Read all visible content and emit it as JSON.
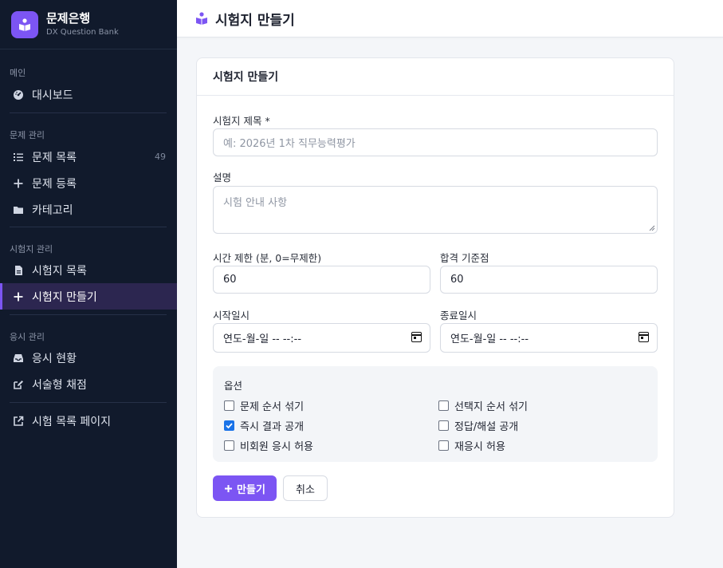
{
  "brand": {
    "title": "문제은행",
    "subtitle": "DX Question Bank"
  },
  "sidebar": {
    "sections": [
      {
        "label": "메인",
        "items": [
          {
            "label": "대시보드",
            "icon": "dashboard-icon"
          }
        ]
      },
      {
        "label": "문제 관리",
        "items": [
          {
            "label": "문제 목록",
            "icon": "list-icon",
            "count": "49"
          },
          {
            "label": "문제 등록",
            "icon": "plus-icon"
          },
          {
            "label": "카테고리",
            "icon": "folder-icon"
          }
        ]
      },
      {
        "label": "시험지 관리",
        "items": [
          {
            "label": "시험지 목록",
            "icon": "file-icon"
          },
          {
            "label": "시험지 만들기",
            "icon": "plus-icon",
            "active": true
          }
        ]
      },
      {
        "label": "응시 관리",
        "items": [
          {
            "label": "응시 현황",
            "icon": "inbox-icon"
          },
          {
            "label": "서술형 채점",
            "icon": "edit-icon"
          }
        ]
      }
    ],
    "footer_item": {
      "label": "시험 목록 페이지",
      "icon": "external-link-icon"
    }
  },
  "header": {
    "title": "시험지 만들기"
  },
  "form": {
    "card_title": "시험지 만들기",
    "title_label": "시험지 제목 *",
    "title_placeholder": "예: 2026년 1차 직무능력평가",
    "desc_label": "설명",
    "desc_placeholder": "시험 안내 사항",
    "time_label": "시간 제한 (분, 0=무제한)",
    "time_value": "60",
    "pass_label": "합격 기준점",
    "pass_value": "60",
    "start_label": "시작일시",
    "start_value": "연도-월-일 -- --:--",
    "end_label": "종료일시",
    "end_value": "연도-월-일 -- --:--",
    "options_title": "옵션",
    "options": [
      {
        "label": "문제 순서 섞기",
        "checked": false
      },
      {
        "label": "선택지 순서 섞기",
        "checked": false
      },
      {
        "label": "즉시 결과 공개",
        "checked": true
      },
      {
        "label": "정답/해설 공개",
        "checked": false
      },
      {
        "label": "비회원 응시 허용",
        "checked": false
      },
      {
        "label": "재응시 허용",
        "checked": false
      }
    ],
    "submit_label": "만들기",
    "cancel_label": "취소"
  },
  "colors": {
    "accent": "#7c55f3",
    "sidebar_bg": "#111a2c",
    "checkbox_checked": "#1a73e8"
  }
}
